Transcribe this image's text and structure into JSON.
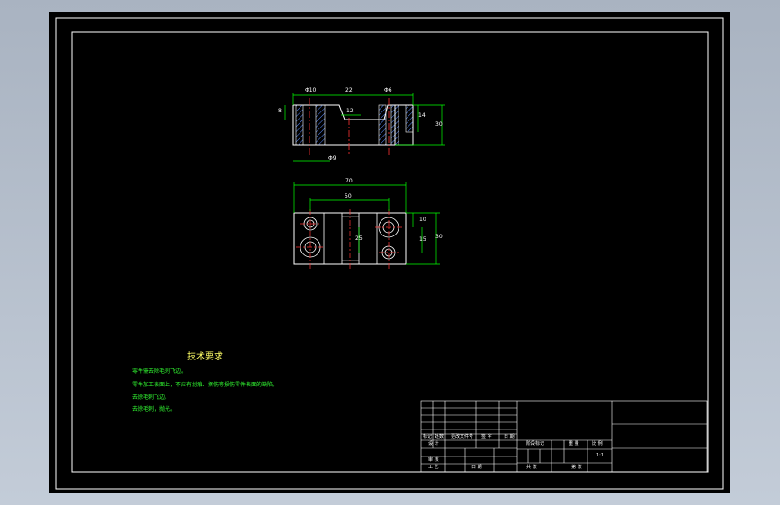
{
  "drawing": {
    "dimensions_top_view": {
      "hole_dia_left": "Φ10",
      "width_middle": "22",
      "hole_dia_right": "Φ6",
      "height_left": "8",
      "slot_width": "12",
      "height_right_small": "14",
      "overall_height": "30",
      "bottom_dia": "Φ9"
    },
    "dimensions_front_view": {
      "overall_length": "70",
      "center_distance": "50",
      "height_right_1": "10",
      "height_right_2": "15",
      "overall_width": "30",
      "middle_dim": "25"
    }
  },
  "technical_requirements": {
    "title": "技术要求",
    "items": [
      "零件需去除毛刺飞边。",
      "零件加工表面上，不应有划痕、擦伤等损伤零件表面的缺陷。",
      "去除毛刺飞边。",
      "去除毛刺，抛光。"
    ]
  },
  "title_block": {
    "row_labels": [
      "标记",
      "处数",
      "更改文件号",
      "签 字",
      "日 期"
    ],
    "design_label": "设 计",
    "review_label": "审 核",
    "craft_label": "工 艺",
    "approve_label": "批 准",
    "stage_label": "阶段标记",
    "weight_label": "重 量",
    "scale_label": "比 例",
    "scale_value": "1:1",
    "sheet_label": "共   张",
    "sheet_of_label": "第   张",
    "date_label": "日 期"
  },
  "colors": {
    "background": "#000000",
    "outline": "#ffffff",
    "dimension": "#00ff00",
    "centerline": "#ff3333",
    "hatch": "#5a8dff",
    "notes_title": "#ffff66",
    "notes_text": "#33ff33"
  }
}
